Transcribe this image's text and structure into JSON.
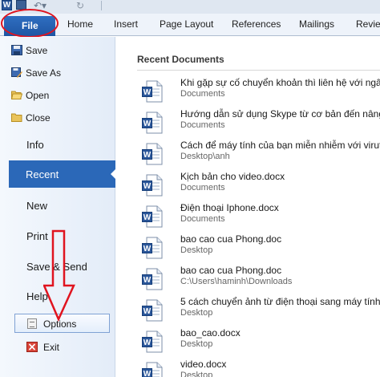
{
  "quick_access": {
    "app_icon_letter": "W"
  },
  "ribbon": {
    "tabs": [
      {
        "label": "File"
      },
      {
        "label": "Home"
      },
      {
        "label": "Insert"
      },
      {
        "label": "Page Layout"
      },
      {
        "label": "References"
      },
      {
        "label": "Mailings"
      },
      {
        "label": "Review"
      }
    ]
  },
  "backstage": {
    "commands": [
      {
        "label": "Save",
        "icon": "save-icon"
      },
      {
        "label": "Save As",
        "icon": "save-as-icon"
      },
      {
        "label": "Open",
        "icon": "open-folder-icon"
      },
      {
        "label": "Close",
        "icon": "close-folder-icon"
      }
    ],
    "nav": {
      "info": "Info",
      "recent": "Recent",
      "new": "New",
      "print": "Print",
      "save_send": "Save & Send",
      "help": "Help"
    },
    "options_label": "Options",
    "exit_label": "Exit"
  },
  "recent": {
    "heading": "Recent Documents",
    "documents": [
      {
        "name": "Khi gặp sự cố chuyển khoản thì liên hệ với ngân",
        "path": "Documents"
      },
      {
        "name": "Hướng dẫn sử dụng Skype từ cơ bản đến nâng",
        "path": "Documents"
      },
      {
        "name": "Cách để máy tính của bạn miễn nhiễm với virut",
        "path": "Desktop\\anh"
      },
      {
        "name": "Kịch bản cho video.docx",
        "path": "Documents"
      },
      {
        "name": "Điện thoại Iphone.docx",
        "path": "Documents"
      },
      {
        "name": "bao cao cua Phong.doc",
        "path": "Desktop"
      },
      {
        "name": "bao cao cua Phong.doc",
        "path": "C:\\Users\\haminh\\Downloads"
      },
      {
        "name": "5 cách chuyển ảnh từ điện thoại sang máy tính",
        "path": "Desktop"
      },
      {
        "name": "bao_cao.docx",
        "path": "Desktop"
      },
      {
        "name": "video.docx",
        "path": "Desktop"
      }
    ]
  },
  "colors": {
    "file_tab": "#2b68b8",
    "selected_nav": "#2b68b8",
    "annotation": "#e0141f"
  }
}
